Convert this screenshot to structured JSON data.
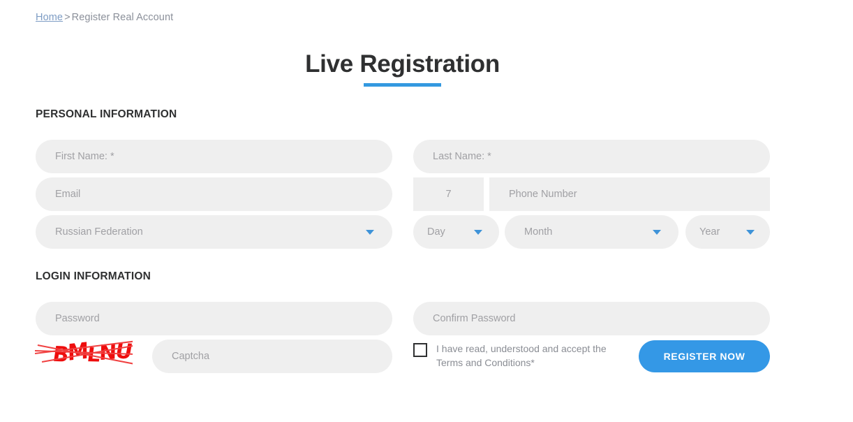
{
  "breadcrumb": {
    "home_label": "Home",
    "separator": ">",
    "current": "Register Real Account"
  },
  "header": {
    "title": "Live Registration",
    "accent_color": "#3399e0"
  },
  "sections": {
    "personal": {
      "heading": "PERSONAL INFORMATION",
      "first_name_placeholder": "First Name: *",
      "last_name_placeholder": "Last Name: *",
      "email_placeholder": "Email",
      "country_code_value": "7",
      "phone_placeholder": "Phone Number",
      "country_value": "Russian Federation",
      "day_value": "Day",
      "month_value": "Month",
      "year_value": "Year"
    },
    "login": {
      "heading": "LOGIN INFORMATION",
      "password_placeholder": "Password",
      "confirm_password_placeholder": "Confirm Password",
      "captcha_placeholder": "Captcha",
      "captcha_code": "BMLNU",
      "captcha_color": "#ee0d0d",
      "terms_text": "I have read, understood and accept the Terms and Conditions*",
      "register_button_label": "REGISTER NOW",
      "register_button_color": "#3498e6"
    }
  }
}
